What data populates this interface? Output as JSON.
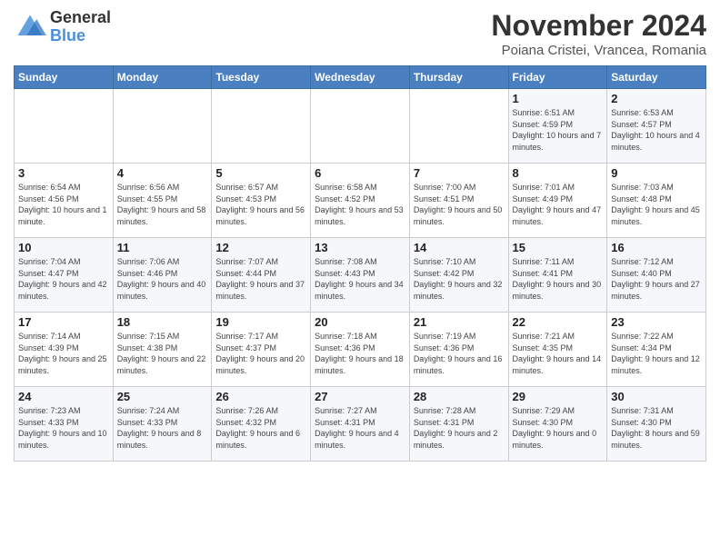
{
  "header": {
    "logo_line1": "General",
    "logo_line2": "Blue",
    "title": "November 2024",
    "subtitle": "Poiana Cristei, Vrancea, Romania"
  },
  "days_of_week": [
    "Sunday",
    "Monday",
    "Tuesday",
    "Wednesday",
    "Thursday",
    "Friday",
    "Saturday"
  ],
  "weeks": [
    [
      {
        "num": "",
        "info": ""
      },
      {
        "num": "",
        "info": ""
      },
      {
        "num": "",
        "info": ""
      },
      {
        "num": "",
        "info": ""
      },
      {
        "num": "",
        "info": ""
      },
      {
        "num": "1",
        "info": "Sunrise: 6:51 AM\nSunset: 4:59 PM\nDaylight: 10 hours and 7 minutes."
      },
      {
        "num": "2",
        "info": "Sunrise: 6:53 AM\nSunset: 4:57 PM\nDaylight: 10 hours and 4 minutes."
      }
    ],
    [
      {
        "num": "3",
        "info": "Sunrise: 6:54 AM\nSunset: 4:56 PM\nDaylight: 10 hours and 1 minute."
      },
      {
        "num": "4",
        "info": "Sunrise: 6:56 AM\nSunset: 4:55 PM\nDaylight: 9 hours and 58 minutes."
      },
      {
        "num": "5",
        "info": "Sunrise: 6:57 AM\nSunset: 4:53 PM\nDaylight: 9 hours and 56 minutes."
      },
      {
        "num": "6",
        "info": "Sunrise: 6:58 AM\nSunset: 4:52 PM\nDaylight: 9 hours and 53 minutes."
      },
      {
        "num": "7",
        "info": "Sunrise: 7:00 AM\nSunset: 4:51 PM\nDaylight: 9 hours and 50 minutes."
      },
      {
        "num": "8",
        "info": "Sunrise: 7:01 AM\nSunset: 4:49 PM\nDaylight: 9 hours and 47 minutes."
      },
      {
        "num": "9",
        "info": "Sunrise: 7:03 AM\nSunset: 4:48 PM\nDaylight: 9 hours and 45 minutes."
      }
    ],
    [
      {
        "num": "10",
        "info": "Sunrise: 7:04 AM\nSunset: 4:47 PM\nDaylight: 9 hours and 42 minutes."
      },
      {
        "num": "11",
        "info": "Sunrise: 7:06 AM\nSunset: 4:46 PM\nDaylight: 9 hours and 40 minutes."
      },
      {
        "num": "12",
        "info": "Sunrise: 7:07 AM\nSunset: 4:44 PM\nDaylight: 9 hours and 37 minutes."
      },
      {
        "num": "13",
        "info": "Sunrise: 7:08 AM\nSunset: 4:43 PM\nDaylight: 9 hours and 34 minutes."
      },
      {
        "num": "14",
        "info": "Sunrise: 7:10 AM\nSunset: 4:42 PM\nDaylight: 9 hours and 32 minutes."
      },
      {
        "num": "15",
        "info": "Sunrise: 7:11 AM\nSunset: 4:41 PM\nDaylight: 9 hours and 30 minutes."
      },
      {
        "num": "16",
        "info": "Sunrise: 7:12 AM\nSunset: 4:40 PM\nDaylight: 9 hours and 27 minutes."
      }
    ],
    [
      {
        "num": "17",
        "info": "Sunrise: 7:14 AM\nSunset: 4:39 PM\nDaylight: 9 hours and 25 minutes."
      },
      {
        "num": "18",
        "info": "Sunrise: 7:15 AM\nSunset: 4:38 PM\nDaylight: 9 hours and 22 minutes."
      },
      {
        "num": "19",
        "info": "Sunrise: 7:17 AM\nSunset: 4:37 PM\nDaylight: 9 hours and 20 minutes."
      },
      {
        "num": "20",
        "info": "Sunrise: 7:18 AM\nSunset: 4:36 PM\nDaylight: 9 hours and 18 minutes."
      },
      {
        "num": "21",
        "info": "Sunrise: 7:19 AM\nSunset: 4:36 PM\nDaylight: 9 hours and 16 minutes."
      },
      {
        "num": "22",
        "info": "Sunrise: 7:21 AM\nSunset: 4:35 PM\nDaylight: 9 hours and 14 minutes."
      },
      {
        "num": "23",
        "info": "Sunrise: 7:22 AM\nSunset: 4:34 PM\nDaylight: 9 hours and 12 minutes."
      }
    ],
    [
      {
        "num": "24",
        "info": "Sunrise: 7:23 AM\nSunset: 4:33 PM\nDaylight: 9 hours and 10 minutes."
      },
      {
        "num": "25",
        "info": "Sunrise: 7:24 AM\nSunset: 4:33 PM\nDaylight: 9 hours and 8 minutes."
      },
      {
        "num": "26",
        "info": "Sunrise: 7:26 AM\nSunset: 4:32 PM\nDaylight: 9 hours and 6 minutes."
      },
      {
        "num": "27",
        "info": "Sunrise: 7:27 AM\nSunset: 4:31 PM\nDaylight: 9 hours and 4 minutes."
      },
      {
        "num": "28",
        "info": "Sunrise: 7:28 AM\nSunset: 4:31 PM\nDaylight: 9 hours and 2 minutes."
      },
      {
        "num": "29",
        "info": "Sunrise: 7:29 AM\nSunset: 4:30 PM\nDaylight: 9 hours and 0 minutes."
      },
      {
        "num": "30",
        "info": "Sunrise: 7:31 AM\nSunset: 4:30 PM\nDaylight: 8 hours and 59 minutes."
      }
    ]
  ]
}
